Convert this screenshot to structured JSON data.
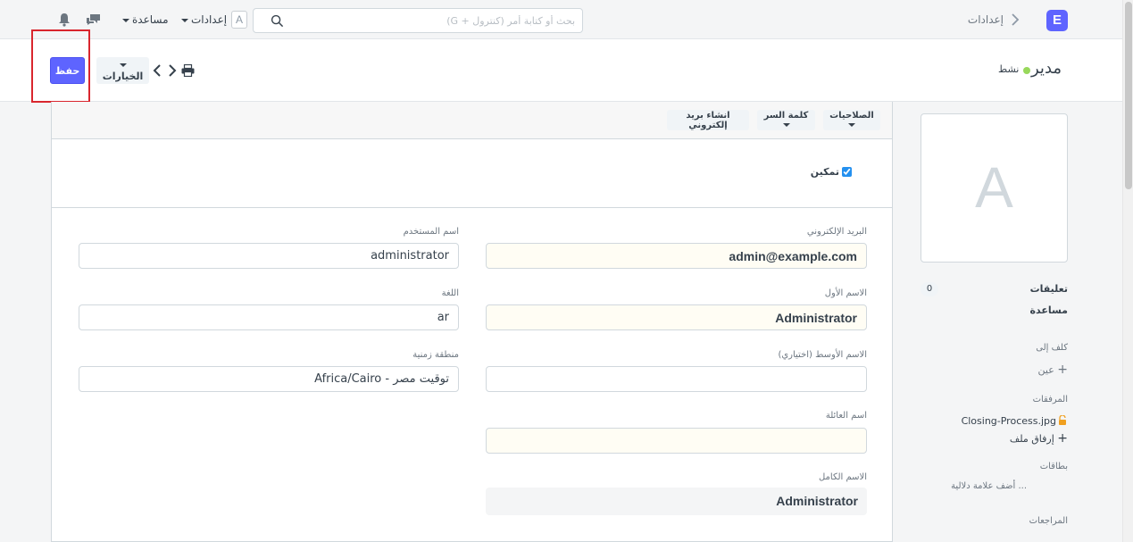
{
  "navbar": {
    "logo_letter": "E",
    "breadcrumb": "إعدادات",
    "search_placeholder": "بحث أو كتابة أمر (كنترول + G)",
    "user_initial": "A",
    "settings_label": "إعدادات",
    "help_label": "مساعدة"
  },
  "page": {
    "title": "مدير",
    "status": "نشط",
    "save_label": "حفظ",
    "options_label": "الخيارات",
    "highlight_color": "#d9262e"
  },
  "toolbar": {
    "permissions": "الصلاحيات",
    "password": "كلمة السر",
    "create_email": "انشاء بريد إلكتروني"
  },
  "form": {
    "enable_label": "تمكين",
    "enabled": true,
    "email": {
      "label": "البريد الإلكتروني",
      "value": "admin@example.com"
    },
    "username": {
      "label": "اسم المستخدم",
      "value": "administrator"
    },
    "first_name": {
      "label": "الاسم الأول",
      "value": "Administrator"
    },
    "language": {
      "label": "اللغة",
      "value": "ar"
    },
    "middle_name": {
      "label": "الاسم الأوسط (اختياري)",
      "value": ""
    },
    "time_zone": {
      "label": "منطقة زمنية",
      "value": "توقيت مصر - Africa/Cairo"
    },
    "last_name": {
      "label": "اسم العائلة",
      "value": ""
    },
    "full_name": {
      "label": "الاسم الكامل",
      "value": "Administrator"
    }
  },
  "sidebar": {
    "avatar_letter": "A",
    "comments_label": "تعليقات",
    "comments_count": "0",
    "help_label": "مساعدة",
    "assigned_to_label": "كلف إلى",
    "assign_label": "عين",
    "attachments_label": "المرفقات",
    "attachment_file": "Closing-Process.jpg",
    "attach_file_label": "إرفاق ملف",
    "tags_label": "بطاقات",
    "add_tag_label": "أضف علامة دلالية ...",
    "reviews_label": "المراجعات"
  },
  "colors": {
    "primary": "#5e64ff",
    "status_active": "#98d85b",
    "mandatory_bg": "#fffdf4"
  }
}
